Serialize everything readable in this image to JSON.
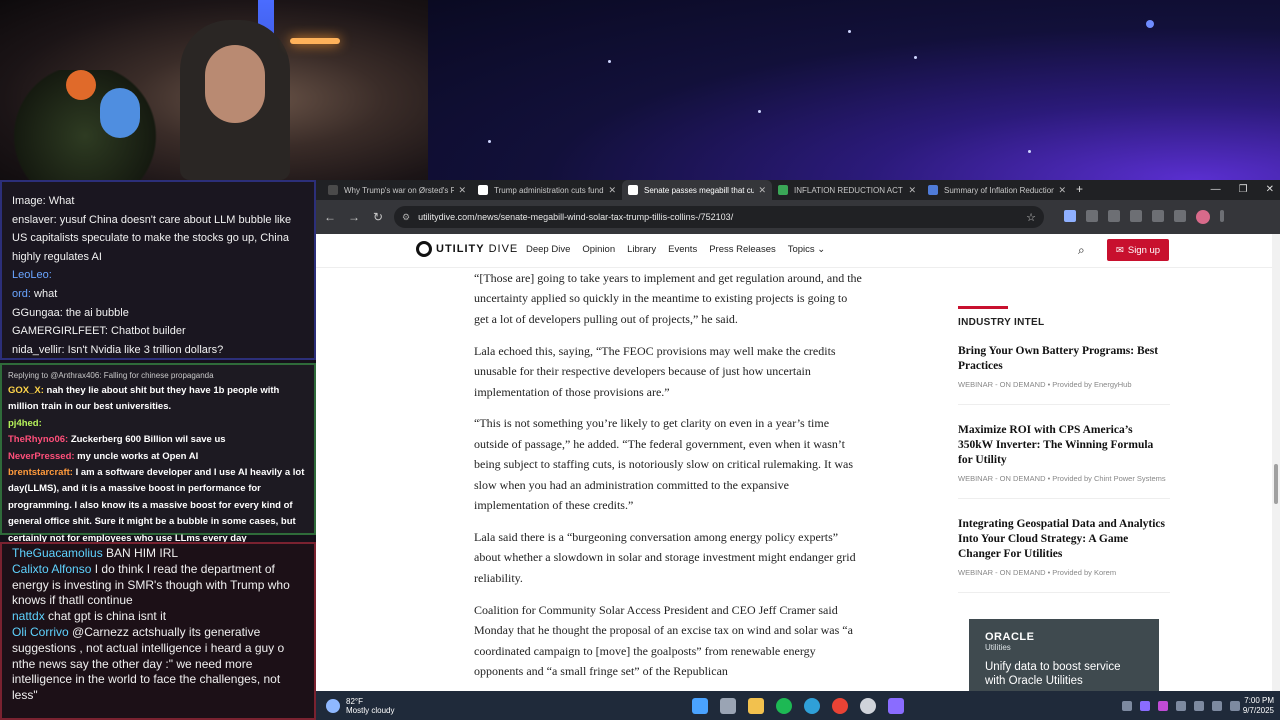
{
  "chat": {
    "top": [
      {
        "user": "Image:",
        "user_color": "#f2f2f2",
        "text": " What"
      },
      {
        "user": "enslaver:",
        "user_color": "#f2f2f2",
        "text": " yusuf China doesn't care about LLM bubble like"
      },
      {
        "user": "",
        "user_color": "#f2f2f2",
        "text": "US capitalists speculate to make the stocks go up, China"
      },
      {
        "user": "",
        "user_color": "#f2f2f2",
        "text": "highly regulates AI"
      },
      {
        "user": "LeoLeo:",
        "user_color": "#6aa5ff",
        "text": ""
      },
      {
        "user": "ord:",
        "user_color": "#6aa5ff",
        "text": " what"
      },
      {
        "user": "GGungaa:",
        "user_color": "#f2f2f2",
        "text": " the ai bubble"
      },
      {
        "user": "GAMERGIRLFEET:",
        "user_color": "#f2f2f2",
        "text": " Chatbot builder"
      },
      {
        "user": "nida_vellir:",
        "user_color": "#f2f2f2",
        "text": " Isn't Nvidia like 3 trillion dollars?"
      }
    ],
    "mid_reply": "Replying to @Anthrax406: Falling for chinese propaganda",
    "mid": [
      {
        "user": "GOX_X:",
        "user_color": "#ffd54a",
        "text": " nah they lie about shit but they have 1b people with million train in our best universities."
      },
      {
        "user": "pj4hed:",
        "user_color": "#b6f25a",
        "text": ""
      },
      {
        "user": "TheRhyno06:",
        "user_color": "#ff4f7a",
        "text": " Zuckerberg 600 Billion wil save us"
      },
      {
        "user": "NeverPressed:",
        "user_color": "#ff4f7a",
        "text": " my uncle works at Open AI"
      },
      {
        "user": "brentstarcraft:",
        "user_color": "#ff9a3c",
        "text": " I am a software developer and I use AI heavily a lot day(LLMS), and it is a massive boost in performance for programming. I also know its a massive boost for every kind of general office shit. Sure it might be a bubble in some cases, but certainly not for employees who use LLms every day"
      }
    ],
    "bottom": [
      {
        "user": "TheGuacamolius",
        "user_color": "#5fd3ff",
        "text": " BAN HIM IRL"
      },
      {
        "user": "Calixto Alfonso",
        "user_color": "#5fd3ff",
        "text": " I do think I read the department of energy is investing in SMR's though with Trump who knows if thatll continue"
      },
      {
        "user": "nattdx",
        "user_color": "#5fd3ff",
        "text": " chat gpt is china isnt it"
      },
      {
        "user": "Oli Corrivo",
        "user_color": "#5fd3ff",
        "text": " @Carnezz actshually its generative suggestions , not actual intelligence  i heard a guy o nthe news say the other day :\" we need more intelligence in the world to face the challenges, not less\""
      }
    ]
  },
  "browser": {
    "tabs": [
      {
        "label": "Why Trump's war on Ørsted's R",
        "fav_color": "#4a4a4a",
        "active": false
      },
      {
        "label": "Trump administration cuts fund",
        "fav_color": "#ffffff",
        "active": false
      },
      {
        "label": "Senate passes megabill that cu",
        "fav_color": "#ffffff",
        "active": true
      },
      {
        "label": "INFLATION REDUCTION ACT O",
        "fav_color": "#3aa757",
        "active": false
      },
      {
        "label": "Summary of Inflation Reduction",
        "fav_color": "#4f7bd8",
        "active": false
      }
    ],
    "url": "utilitydive.com/news/senate-megabill-wind-solar-tax-trump-tillis-collins-/752103/"
  },
  "site": {
    "logo_a": "UTILITY",
    "logo_b": "DIVE",
    "menu": [
      "Deep Dive",
      "Opinion",
      "Library",
      "Events",
      "Press Releases",
      "Topics ⌄"
    ],
    "signup": "Sign up"
  },
  "article": {
    "paragraphs": [
      "“[Those are] going to take years to implement and get regulation around, and the uncertainty applied so quickly in the meantime to existing projects is going to get a lot of developers pulling out of projects,” he said.",
      "Lala echoed this, saying, “The FEOC provisions may well make the credits unusable for their respective developers because of just how uncertain implementation of those provisions are.”",
      "“This is not something you’re likely to get clarity on even in a year’s time outside of passage,” he added. “The federal government, even when it wasn’t being subject to staffing cuts, is notoriously slow on critical rulemaking. It was slow when you had an administration committed to the expansive implementation of these credits.”",
      "Lala said there is a “burgeoning conversation among energy policy experts” about whether a slowdown in solar and storage investment might endanger grid reliability.",
      "Coalition for Community Solar Access President and CEO Jeff Cramer said Monday that he thought the proposal of an excise tax on wind and solar was “a coordinated campaign to [move] the goalposts” from renewable energy opponents and “a small fringe set” of the Republican"
    ]
  },
  "sidebar": {
    "heading": "INDUSTRY INTEL",
    "items": [
      {
        "title": "Bring Your Own Battery Programs: Best Practices",
        "meta": "WEBINAR - ON DEMAND • Provided by EnergyHub"
      },
      {
        "title": "Maximize ROI with CPS America’s 350kW Inverter: The Winning Formula for Utility",
        "meta": "WEBINAR - ON DEMAND • Provided by Chint Power Systems"
      },
      {
        "title": "Integrating Geospatial Data and Analytics Into Your Cloud Strategy: A Game Changer For Utilities",
        "meta": "WEBINAR - ON DEMAND • Provided by Korem"
      }
    ]
  },
  "ad": {
    "brand": "ORACLE",
    "sub": "Utilities",
    "text": "Unify data to boost service with Oracle Utilities"
  },
  "taskbar": {
    "temp": "82°F",
    "condition": "Mostly cloudy",
    "time": "7:00 PM",
    "date": "9/7/2025"
  }
}
